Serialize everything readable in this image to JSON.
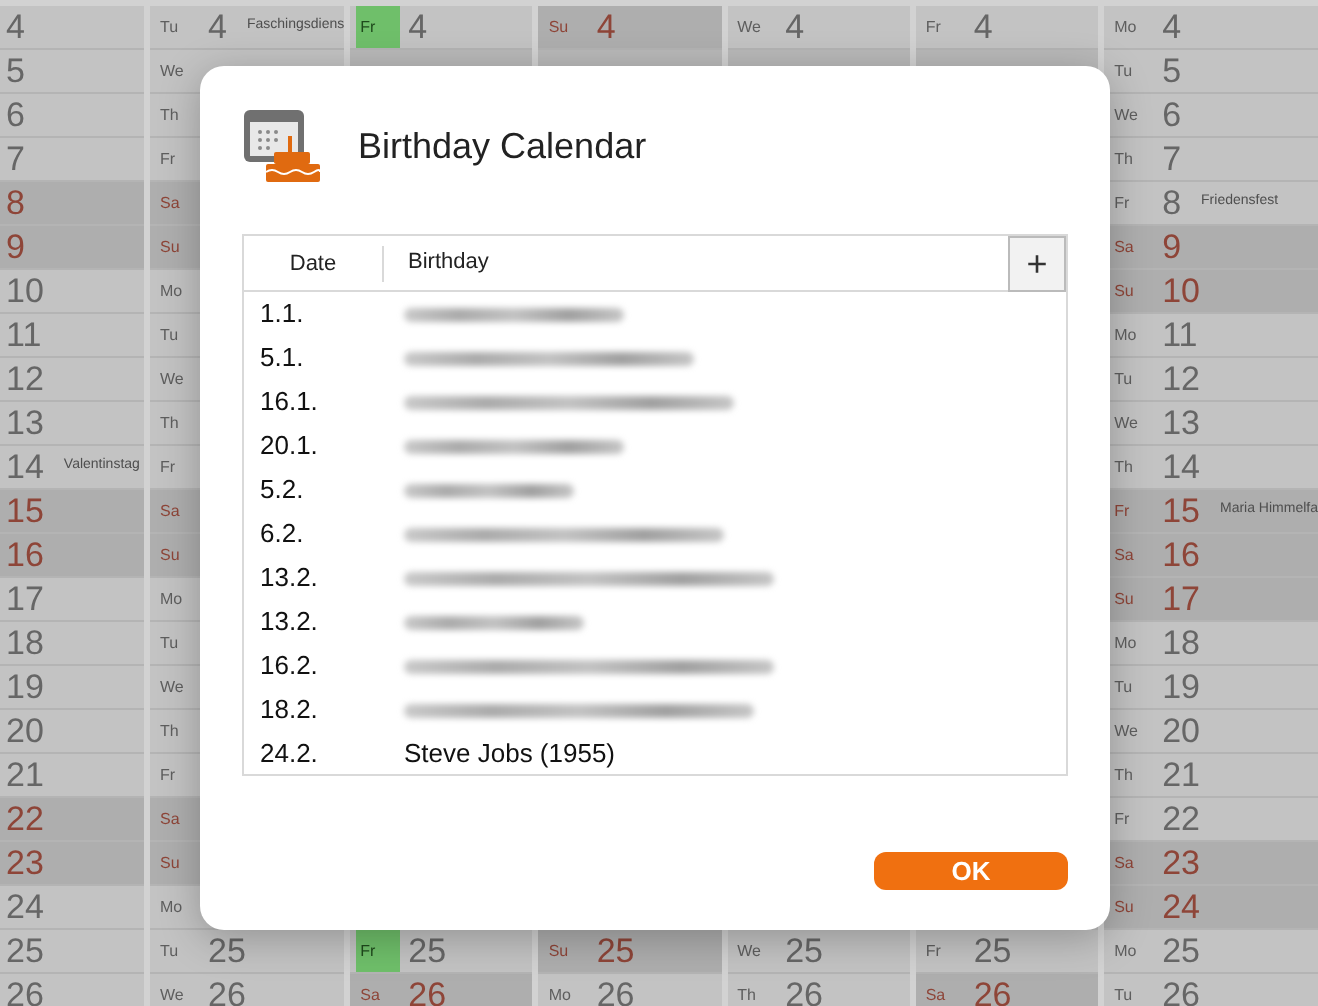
{
  "calendar": {
    "columns": [
      {
        "cells": [
          {
            "day": "4"
          },
          {
            "day": "5"
          },
          {
            "day": "6"
          },
          {
            "day": "7"
          },
          {
            "day": "8",
            "holiday": true
          },
          {
            "day": "9",
            "holiday": true
          },
          {
            "day": "10"
          },
          {
            "day": "11"
          },
          {
            "day": "12"
          },
          {
            "day": "13"
          },
          {
            "day": "14",
            "note": "Valentinstag"
          },
          {
            "day": "15",
            "holiday": true
          },
          {
            "day": "16",
            "holiday": true
          },
          {
            "day": "17"
          },
          {
            "day": "18"
          },
          {
            "day": "19"
          },
          {
            "day": "20"
          },
          {
            "day": "21"
          },
          {
            "day": "22",
            "holiday": true
          },
          {
            "day": "23",
            "holiday": true
          },
          {
            "day": "24"
          },
          {
            "day": "25"
          },
          {
            "day": "26"
          }
        ]
      },
      {
        "cells": [
          {
            "weekday": "Tu",
            "day": "4",
            "note": "Faschingsdiens"
          },
          {
            "weekday": "We"
          },
          {
            "weekday": "Th"
          },
          {
            "weekday": "Fr"
          },
          {
            "weekday": "Sa",
            "holiday": true
          },
          {
            "weekday": "Su",
            "holiday": true
          },
          {
            "weekday": "Mo"
          },
          {
            "weekday": "Tu"
          },
          {
            "weekday": "We"
          },
          {
            "weekday": "Th"
          },
          {
            "weekday": "Fr"
          },
          {
            "weekday": "Sa",
            "holiday": true
          },
          {
            "weekday": "Su",
            "holiday": true
          },
          {
            "weekday": "Mo"
          },
          {
            "weekday": "Tu"
          },
          {
            "weekday": "We"
          },
          {
            "weekday": "Th"
          },
          {
            "weekday": "Fr"
          },
          {
            "weekday": "Sa",
            "holiday": true
          },
          {
            "weekday": "Su",
            "holiday": true
          },
          {
            "weekday": "Mo"
          },
          {
            "weekday": "Tu",
            "day": "25"
          },
          {
            "weekday": "We",
            "day": "26"
          }
        ]
      },
      {
        "cells": [
          {
            "weekday": "Fr",
            "day": "4",
            "today": true
          }
        ],
        "bottom_cells": [
          {
            "weekday": "Fr",
            "day": "25",
            "today": true
          },
          {
            "weekday": "Sa",
            "day": "26",
            "holiday": true
          }
        ]
      },
      {
        "cells": [
          {
            "weekday": "Su",
            "day": "4",
            "holiday": true
          }
        ],
        "bottom_cells": [
          {
            "weekday": "Su",
            "day": "25",
            "holiday": true
          },
          {
            "weekday": "Mo",
            "day": "26"
          }
        ]
      },
      {
        "cells": [
          {
            "weekday": "We",
            "day": "4"
          }
        ],
        "bottom_cells": [
          {
            "weekday": "We",
            "day": "25"
          },
          {
            "weekday": "Th",
            "day": "26"
          }
        ]
      },
      {
        "cells": [
          {
            "weekday": "Fr",
            "day": "4"
          }
        ],
        "bottom_cells": [
          {
            "weekday": "Fr",
            "day": "25"
          },
          {
            "weekday": "Sa",
            "day": "26",
            "holiday": true
          }
        ]
      },
      {
        "cells": [
          {
            "weekday": "Mo",
            "day": "4"
          },
          {
            "weekday": "Tu",
            "day": "5"
          },
          {
            "weekday": "We",
            "day": "6"
          },
          {
            "weekday": "Th",
            "day": "7"
          },
          {
            "weekday": "Fr",
            "day": "8",
            "note": "Friedensfest"
          },
          {
            "weekday": "Sa",
            "day": "9",
            "holiday": true
          },
          {
            "weekday": "Su",
            "day": "10",
            "holiday": true
          },
          {
            "weekday": "Mo",
            "day": "11"
          },
          {
            "weekday": "Tu",
            "day": "12"
          },
          {
            "weekday": "We",
            "day": "13"
          },
          {
            "weekday": "Th",
            "day": "14"
          },
          {
            "weekday": "Fr",
            "day": "15",
            "holiday": true,
            "note": "Maria Himmelfa"
          },
          {
            "weekday": "Sa",
            "day": "16",
            "holiday": true
          },
          {
            "weekday": "Su",
            "day": "17",
            "holiday": true
          },
          {
            "weekday": "Mo",
            "day": "18"
          },
          {
            "weekday": "Tu",
            "day": "19"
          },
          {
            "weekday": "We",
            "day": "20"
          },
          {
            "weekday": "Th",
            "day": "21"
          },
          {
            "weekday": "Fr",
            "day": "22"
          },
          {
            "weekday": "Sa",
            "day": "23",
            "holiday": true
          },
          {
            "weekday": "Su",
            "day": "24",
            "holiday": true
          },
          {
            "weekday": "Mo",
            "day": "25"
          },
          {
            "weekday": "Tu",
            "day": "26"
          }
        ]
      }
    ]
  },
  "dialog": {
    "title": "Birthday Calendar",
    "table": {
      "columns": [
        "Date",
        "Birthday"
      ],
      "add_button": "+",
      "rows": [
        {
          "date": "1.1.",
          "redacted": true
        },
        {
          "date": "5.1.",
          "redacted": true
        },
        {
          "date": "16.1.",
          "redacted": true
        },
        {
          "date": "20.1.",
          "redacted": true
        },
        {
          "date": "5.2.",
          "redacted": true
        },
        {
          "date": "6.2.",
          "redacted": true
        },
        {
          "date": "13.2.",
          "redacted": true
        },
        {
          "date": "13.2.",
          "redacted": true
        },
        {
          "date": "16.2.",
          "redacted": true
        },
        {
          "date": "18.2.",
          "redacted": true
        },
        {
          "date": "24.2.",
          "birthday": "Steve Jobs (1955)",
          "redacted": false
        }
      ]
    },
    "buttons": [
      "OK"
    ]
  }
}
